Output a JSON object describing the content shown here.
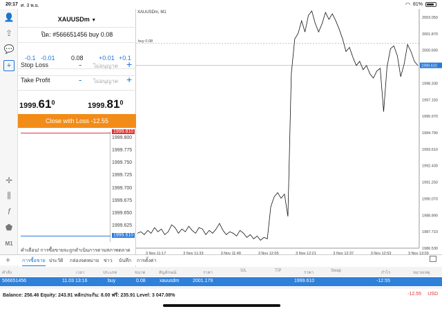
{
  "status": {
    "time": "20:17",
    "date": "ศ. 3 พ.ย.",
    "battery": "81%"
  },
  "left_tools": [
    "person-icon",
    "share-icon",
    "chat-icon",
    "add-icon",
    "crosshair-icon",
    "candles-icon",
    "function-icon",
    "objects-icon",
    "M1"
  ],
  "panel": {
    "symbol": "XAUUSDm",
    "ticket": "ปิด: #566651456 buy 0.08",
    "vol": {
      "m01": "-0.1",
      "m001": "-0.01",
      "value": "0.08",
      "p001": "+0.01",
      "p01": "+0.1"
    },
    "stop_loss": {
      "label": "Stop Loss",
      "value": "ไม่อนุญาต"
    },
    "take_profit": {
      "label": "Take Profit",
      "value": "ไม่อนุญาต"
    },
    "bid": {
      "prefix": "1999.",
      "big": "61",
      "sup": "0"
    },
    "ask": {
      "prefix": "1999.",
      "big": "81",
      "sup": "0"
    },
    "close_button": "Close with Loss -12.55",
    "mini_ticks": [
      "1999.800",
      "1999.775",
      "1999.750",
      "1999.725",
      "1999.700",
      "1999.675",
      "1999.650",
      "1999.625"
    ],
    "mini_red": "1999.810",
    "mini_blue": "1999.610",
    "warning": "คำเตือน! การซื้อขายจะถูกดำเนินการตามสภาพตลาด ความแตกต่างกับราคาที่ส่งอาจมีมาก!"
  },
  "chart_data": {
    "type": "line",
    "title": "XAUUSDm, M1",
    "order_line_label": "buy 0.08",
    "order_price": 2001.179,
    "current_price": "1999.610",
    "ylim": [
      1986.53,
      2003.05
    ],
    "y_ticks": [
      "2003.050",
      "2001.870",
      "2000.690",
      "1999.610",
      "1998.330",
      "1997.150",
      "1995.970",
      "1994.790",
      "1993.610",
      "1992.430",
      "1991.250",
      "1990.070",
      "1988.890",
      "1987.710",
      "1986.530"
    ],
    "x_labels": [
      "3 Nov 11:17",
      "3 Nov 11:33",
      "3 Nov 11:49",
      "3 Nov 12:05",
      "3 Nov 12:21",
      "3 Nov 12:37",
      "3 Nov 12:53",
      "3 Nov 13:09"
    ],
    "values": [
      1987.6,
      1987.7,
      1987.5,
      1987.8,
      1987.6,
      1988.0,
      1987.7,
      1987.9,
      1987.5,
      1987.7,
      1988.2,
      1988.0,
      1987.6,
      1987.9,
      1987.7,
      1988.1,
      1987.8,
      1987.6,
      1988.0,
      1987.9,
      1987.5,
      1987.8,
      1987.6,
      1987.9,
      1988.3,
      1987.8,
      1987.5,
      1987.7,
      1987.6,
      1987.4,
      1987.8,
      1987.6,
      1987.3,
      1987.5,
      1987.2,
      1987.4,
      1987.1,
      1987.3,
      1987.2,
      1989.5,
      1990.2,
      1990.5,
      1990.1,
      1990.4,
      1988.8,
      1999.0,
      2001.5,
      2001.9,
      2002.8,
      2002.0,
      2003.2,
      2003.5,
      2002.6,
      2002.0,
      2002.6,
      2003.4,
      2002.9,
      2003.3,
      2002.8,
      2002.2,
      2001.5,
      2000.6,
      2000.9,
      2000.2,
      1999.6,
      1999.9,
      1999.3,
      1999.6,
      1999.0,
      1998.7,
      1999.2,
      1999.4,
      1996.3,
      1999.5,
      2000.8,
      2001.0,
      2000.3,
      1998.8,
      1999.7,
      2001.1,
      2000.6,
      1999.9,
      1999.6
    ]
  },
  "bottom": {
    "tabs": [
      "การซื้อขาย",
      "ประวัติ",
      "กล่องจดหมาย",
      "ข่าว",
      "บันทึก",
      "การตั้งค่า"
    ],
    "columns": [
      "คำสั่ง",
      "เวลา",
      "ประเภท",
      "ขนาด",
      "สัญลักษณ์",
      "ราคา",
      "S/L",
      "T/P",
      "ราคา",
      "Swap",
      "กำไร",
      "หมายเหตุ"
    ],
    "row": {
      "order": "566651456",
      "time": "11.03 13:16",
      "type": "buy",
      "size": "0.08",
      "symbol": "xauusdm",
      "price": "2001.179",
      "cur_price": "1999.610",
      "profit": "-12.55"
    },
    "balance": "Balance: 256.46  Equity: 243.91  หลักประกัน: 8.00  ฟรี: 235.91  Level: 3 047.08%",
    "total_profit": "-12.55",
    "currency": "USD"
  }
}
